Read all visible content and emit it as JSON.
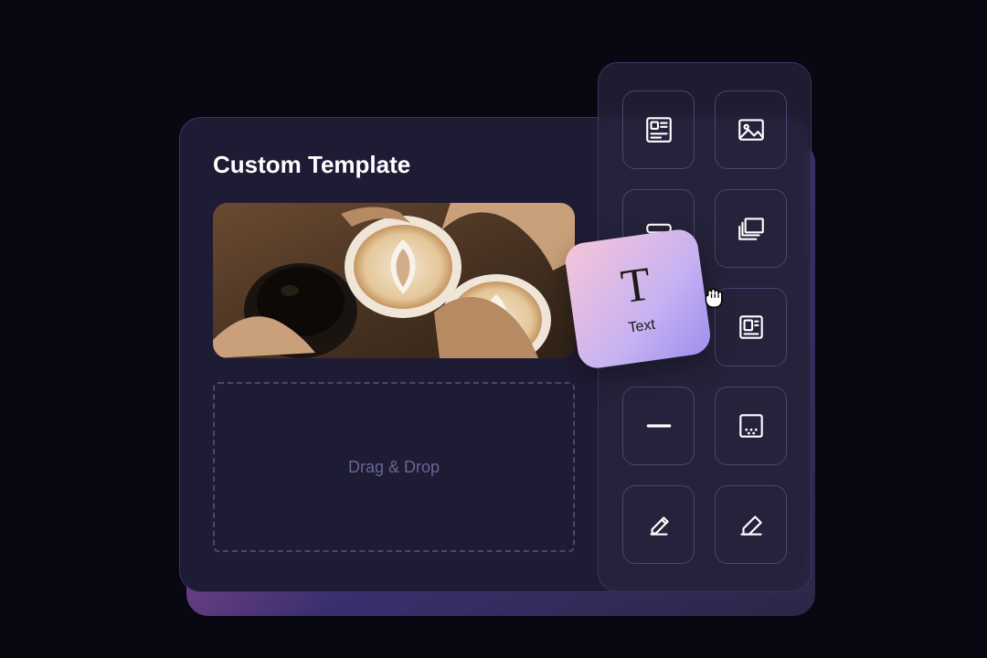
{
  "canvas": {
    "title": "Custom Template",
    "dropzone_label": "Drag & Drop"
  },
  "drag_card": {
    "glyph": "T",
    "label": "Text"
  },
  "tools": [
    {
      "name": "rich-text-icon"
    },
    {
      "name": "image-icon"
    },
    {
      "name": "button-icon"
    },
    {
      "name": "stack-icon"
    },
    {
      "name": "text-icon"
    },
    {
      "name": "layout-block-icon"
    },
    {
      "name": "divider-icon"
    },
    {
      "name": "spacer-dots-icon"
    },
    {
      "name": "signature-icon"
    },
    {
      "name": "edit-box-icon"
    }
  ],
  "cursor": {
    "name": "grab-hand-cursor-icon"
  }
}
